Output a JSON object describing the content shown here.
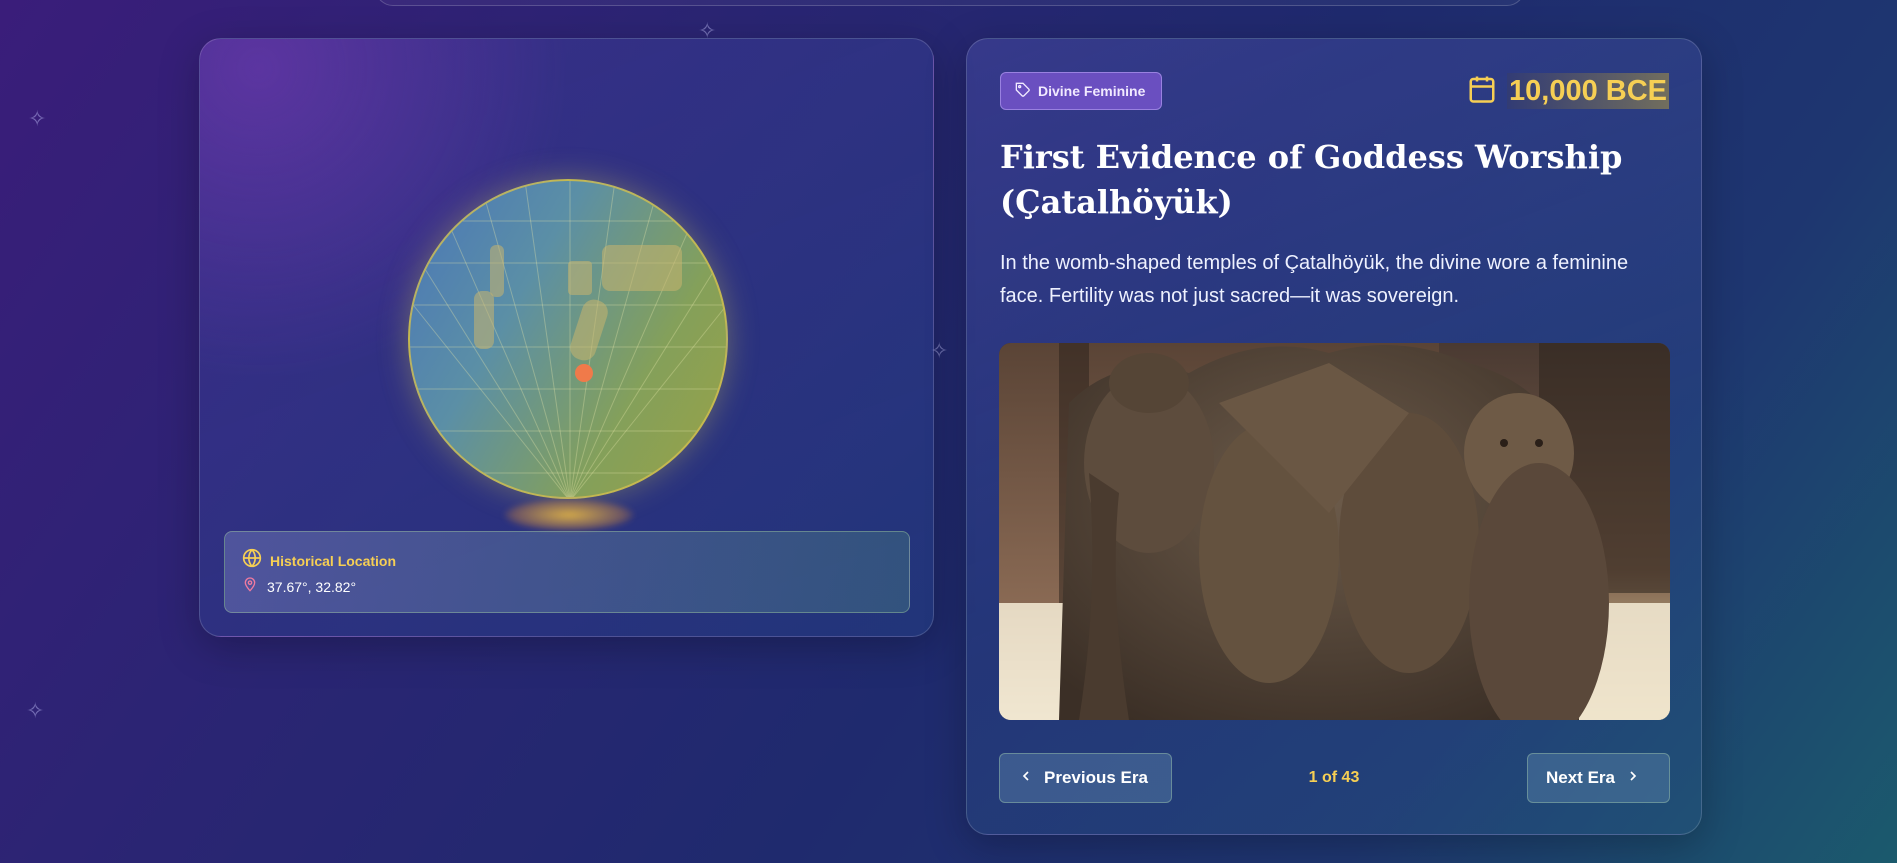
{
  "location": {
    "title": "Historical Location",
    "coordinates": "37.67°, 32.82°"
  },
  "event": {
    "category": "Divine Feminine",
    "date": "10,000 BCE",
    "title": "First Evidence of Goddess Worship (Çatalhöyük)",
    "description": "In the womb-shaped temples of Çatalhöyük, the divine wore a feminine face. Fertility was not just sacred—it was sovereign."
  },
  "navigation": {
    "previous_label": "Previous Era",
    "next_label": "Next Era",
    "counter": "1 of 43"
  },
  "icons": {
    "category": "tag-icon",
    "date": "calendar-icon",
    "location_title": "globe-icon",
    "coordinates": "map-pin-icon",
    "previous": "chevron-left-icon",
    "next": "chevron-right-icon"
  },
  "colors": {
    "accent_gold": "#f6cf54",
    "badge_purple": "#6a4fc0",
    "pin": "#f07a4a"
  }
}
